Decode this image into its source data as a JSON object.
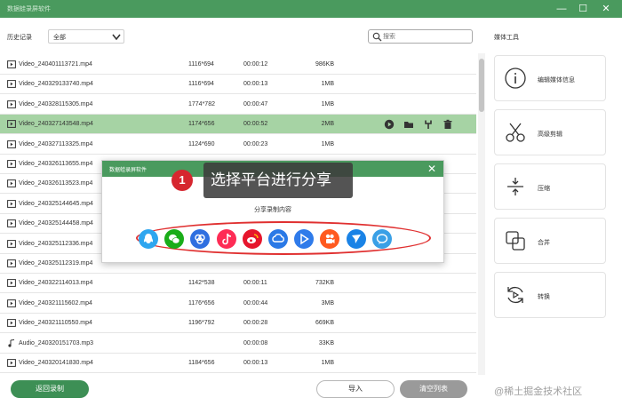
{
  "window": {
    "title": "数据蛙录屏软件"
  },
  "filters": {
    "history_label": "历史记录",
    "filter_value": "全部",
    "search_placeholder": "搜索"
  },
  "list": {
    "rows": [
      {
        "name": "Video_240401113721.mp4",
        "res": "1116*694",
        "dur": "00:00:12",
        "size": "986KB",
        "type": "video"
      },
      {
        "name": "Video_240329133740.mp4",
        "res": "1116*694",
        "dur": "00:00:13",
        "size": "1MB",
        "type": "video"
      },
      {
        "name": "Video_240328115305.mp4",
        "res": "1774*782",
        "dur": "00:00:47",
        "size": "1MB",
        "type": "video"
      },
      {
        "name": "Video_240327143548.mp4",
        "res": "1174*656",
        "dur": "00:00:52",
        "size": "2MB",
        "type": "video",
        "selected": true
      },
      {
        "name": "Video_240327113325.mp4",
        "res": "1124*690",
        "dur": "00:00:23",
        "size": "1MB",
        "type": "video"
      },
      {
        "name": "Video_240326113655.mp4",
        "res": "",
        "dur": "",
        "size": "",
        "type": "video"
      },
      {
        "name": "Video_240326113523.mp4",
        "res": "",
        "dur": "",
        "size": "",
        "type": "video"
      },
      {
        "name": "Video_240325144645.mp4",
        "res": "",
        "dur": "",
        "size": "",
        "type": "video"
      },
      {
        "name": "Video_240325144458.mp4",
        "res": "",
        "dur": "",
        "size": "",
        "type": "video"
      },
      {
        "name": "Video_240325112336.mp4",
        "res": "",
        "dur": "",
        "size": "",
        "type": "video"
      },
      {
        "name": "Video_240325112319.mp4",
        "res": "",
        "dur": "",
        "size": "",
        "type": "video"
      },
      {
        "name": "Video_240322114013.mp4",
        "res": "1142*538",
        "dur": "00:00:11",
        "size": "732KB",
        "type": "video"
      },
      {
        "name": "Video_240321115602.mp4",
        "res": "1176*656",
        "dur": "00:00:44",
        "size": "3MB",
        "type": "video"
      },
      {
        "name": "Video_240321110550.mp4",
        "res": "1196*792",
        "dur": "00:00:28",
        "size": "669KB",
        "type": "video"
      },
      {
        "name": "Audio_240320151703.mp3",
        "res": "",
        "dur": "00:00:08",
        "size": "33KB",
        "type": "audio"
      },
      {
        "name": "Video_240320141830.mp4",
        "res": "1184*656",
        "dur": "00:00:13",
        "size": "1MB",
        "type": "video"
      }
    ],
    "row_actions": [
      "play-icon",
      "folder-icon",
      "wrench-icon",
      "trash-icon"
    ]
  },
  "media_tools": {
    "title": "媒体工具",
    "items": [
      {
        "label": "编辑媒体信息",
        "icon": "info-icon"
      },
      {
        "label": "高级剪辑",
        "icon": "scissors-icon"
      },
      {
        "label": "压缩",
        "icon": "compress-icon"
      },
      {
        "label": "合并",
        "icon": "merge-icon"
      },
      {
        "label": "转换",
        "icon": "convert-icon"
      }
    ]
  },
  "footer": {
    "back_label": "返回录制",
    "import_label": "导入",
    "clear_label": "清空列表",
    "watermark": "@稀土掘金技术社区"
  },
  "dialog": {
    "title": "数据蛙录屏软件",
    "subtitle": "分享录制内容",
    "platforms": [
      {
        "icon": "qq-icon",
        "color": "#2fa6ef"
      },
      {
        "icon": "wechat-icon",
        "color": "#1aad19"
      },
      {
        "icon": "rings-icon",
        "color": "#2f6fe0"
      },
      {
        "icon": "tiktok-icon",
        "color": "#fe2c55"
      },
      {
        "icon": "weibo-icon",
        "color": "#e6162d"
      },
      {
        "icon": "cloud-icon",
        "color": "#2a79e6"
      },
      {
        "icon": "play-store-icon",
        "color": "#2f7bea"
      },
      {
        "icon": "kuaishou-icon",
        "color": "#ff5a1f"
      },
      {
        "icon": "feather-icon",
        "color": "#1a83e6"
      },
      {
        "icon": "chat-bubble-icon",
        "color": "#3aa0e6"
      }
    ]
  },
  "callout": {
    "step": "1",
    "text": "选择平台进行分享"
  }
}
